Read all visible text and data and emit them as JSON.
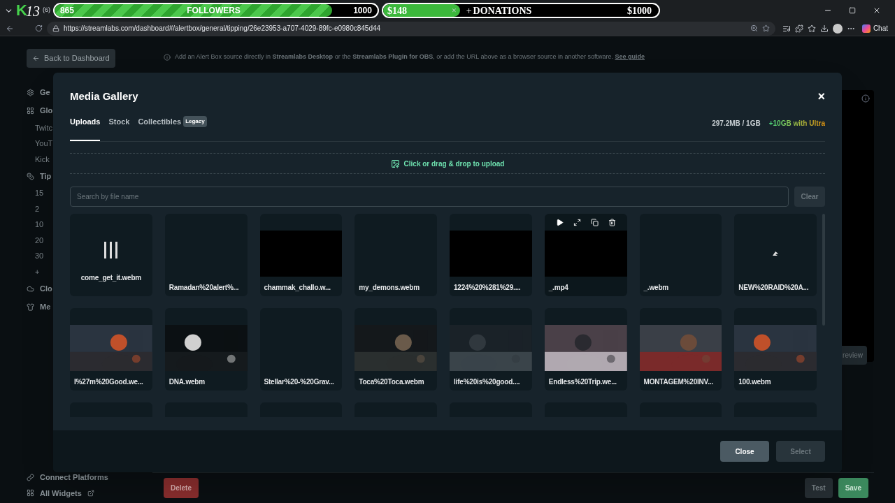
{
  "browser": {
    "logo": {
      "letter": "K",
      "number": "13"
    },
    "tab_count": "(6)",
    "followers_goal": {
      "current": "865",
      "label": "FOLLOWERS",
      "target": "1000",
      "level": 0.86
    },
    "donations_goal": {
      "current": "$148",
      "close": "×",
      "plus": "+",
      "label": "DONATIONS",
      "target": "$1000",
      "level": 0.28
    },
    "url": "https://streamlabs.com/dashboard#/alertbox/general/tipping/26e23953-a707-4029-89fc-e0980c845d44",
    "chat": "Chat"
  },
  "page": {
    "back": "Back to Dashboard",
    "info": "Add an Alert Box source directly in **Streamlabs Desktop** or the **Streamlabs Plugin for OBS**, or add the URL above as a browser source in another software.",
    "info_link": "See guide",
    "sidebar": [
      {
        "kind": "icon",
        "label": "Ge"
      },
      {
        "kind": "icon",
        "label": "Glo"
      },
      {
        "kind": "sub",
        "label": "Twitc"
      },
      {
        "kind": "sub",
        "label": "YouT"
      },
      {
        "kind": "sub",
        "label": "Kick"
      },
      {
        "kind": "icon",
        "label": "Tip"
      },
      {
        "kind": "sub",
        "label": "15"
      },
      {
        "kind": "sub",
        "label": "2"
      },
      {
        "kind": "sub",
        "label": "10"
      },
      {
        "kind": "sub",
        "label": "20"
      },
      {
        "kind": "sub",
        "label": "30"
      },
      {
        "kind": "sub",
        "label": "+"
      },
      {
        "kind": "icon",
        "label": "Clo"
      },
      {
        "kind": "icon",
        "label": "Me"
      }
    ],
    "sidebar_bottom": [
      "Connect Platforms",
      "All Widgets"
    ],
    "review": "review",
    "delete": "Delete",
    "test": "Test",
    "save": "Save"
  },
  "modal": {
    "title": "Media Gallery",
    "close": "×",
    "tabs": [
      {
        "label": "Uploads",
        "selected": true
      },
      {
        "label": "Stock",
        "selected": false
      },
      {
        "label": "Collectibles",
        "badge": "Legacy",
        "selected": false
      }
    ],
    "usage": "297.2MB / 1GB",
    "upgrade": "+10GB with Ultra",
    "upload": "Click or drag & drop to upload",
    "search": {
      "placeholder": "Search by file name"
    },
    "clear": "Clear",
    "items": [
      {
        "name": "come_get_it.webm",
        "kind": "glyph",
        "hovered": false
      },
      {
        "name": "Ramadan%20alert%...",
        "kind": "blank",
        "hovered": false
      },
      {
        "name": "chammak_challo.w...",
        "kind": "black",
        "hovered": false
      },
      {
        "name": "my_demons.webm",
        "kind": "blank",
        "hovered": false
      },
      {
        "name": "1224%20%281%29....",
        "kind": "black",
        "hovered": false
      },
      {
        "name": "_.mp4",
        "kind": "black",
        "hovered": true
      },
      {
        "name": "_.webm",
        "kind": "blank",
        "hovered": false
      },
      {
        "name": "NEW%20RAID%20A...",
        "kind": "mark",
        "hovered": false
      },
      {
        "name": "I%27m%20Good.we...",
        "kind": "picture",
        "hovered": false
      },
      {
        "name": "DNA.webm",
        "kind": "picture",
        "hovered": false
      },
      {
        "name": "Stellar%20-%20Grav...",
        "kind": "blank",
        "hovered": false
      },
      {
        "name": "Toca%20Toca.webm",
        "kind": "picture",
        "hovered": false
      },
      {
        "name": "life%20is%20good....",
        "kind": "picture",
        "hovered": false
      },
      {
        "name": "Endless%20Trip.we...",
        "kind": "picture",
        "hovered": false
      },
      {
        "name": "MONTAGEM%20INV...",
        "kind": "picture",
        "hovered": false
      },
      {
        "name": "100.webm",
        "kind": "picture",
        "hovered": false
      },
      {
        "kind": "blank",
        "hovered": false
      },
      {
        "kind": "blank",
        "hovered": false
      },
      {
        "kind": "blank",
        "hovered": false
      },
      {
        "kind": "blank",
        "hovered": false
      },
      {
        "kind": "blank",
        "hovered": false
      },
      {
        "kind": "blank",
        "hovered": false
      },
      {
        "kind": "blank",
        "hovered": false
      },
      {
        "kind": "blank",
        "hovered": false
      }
    ],
    "buttons": [
      {
        "label": "Close",
        "disabled": false
      },
      {
        "label": "Select",
        "disabled": true
      }
    ]
  }
}
